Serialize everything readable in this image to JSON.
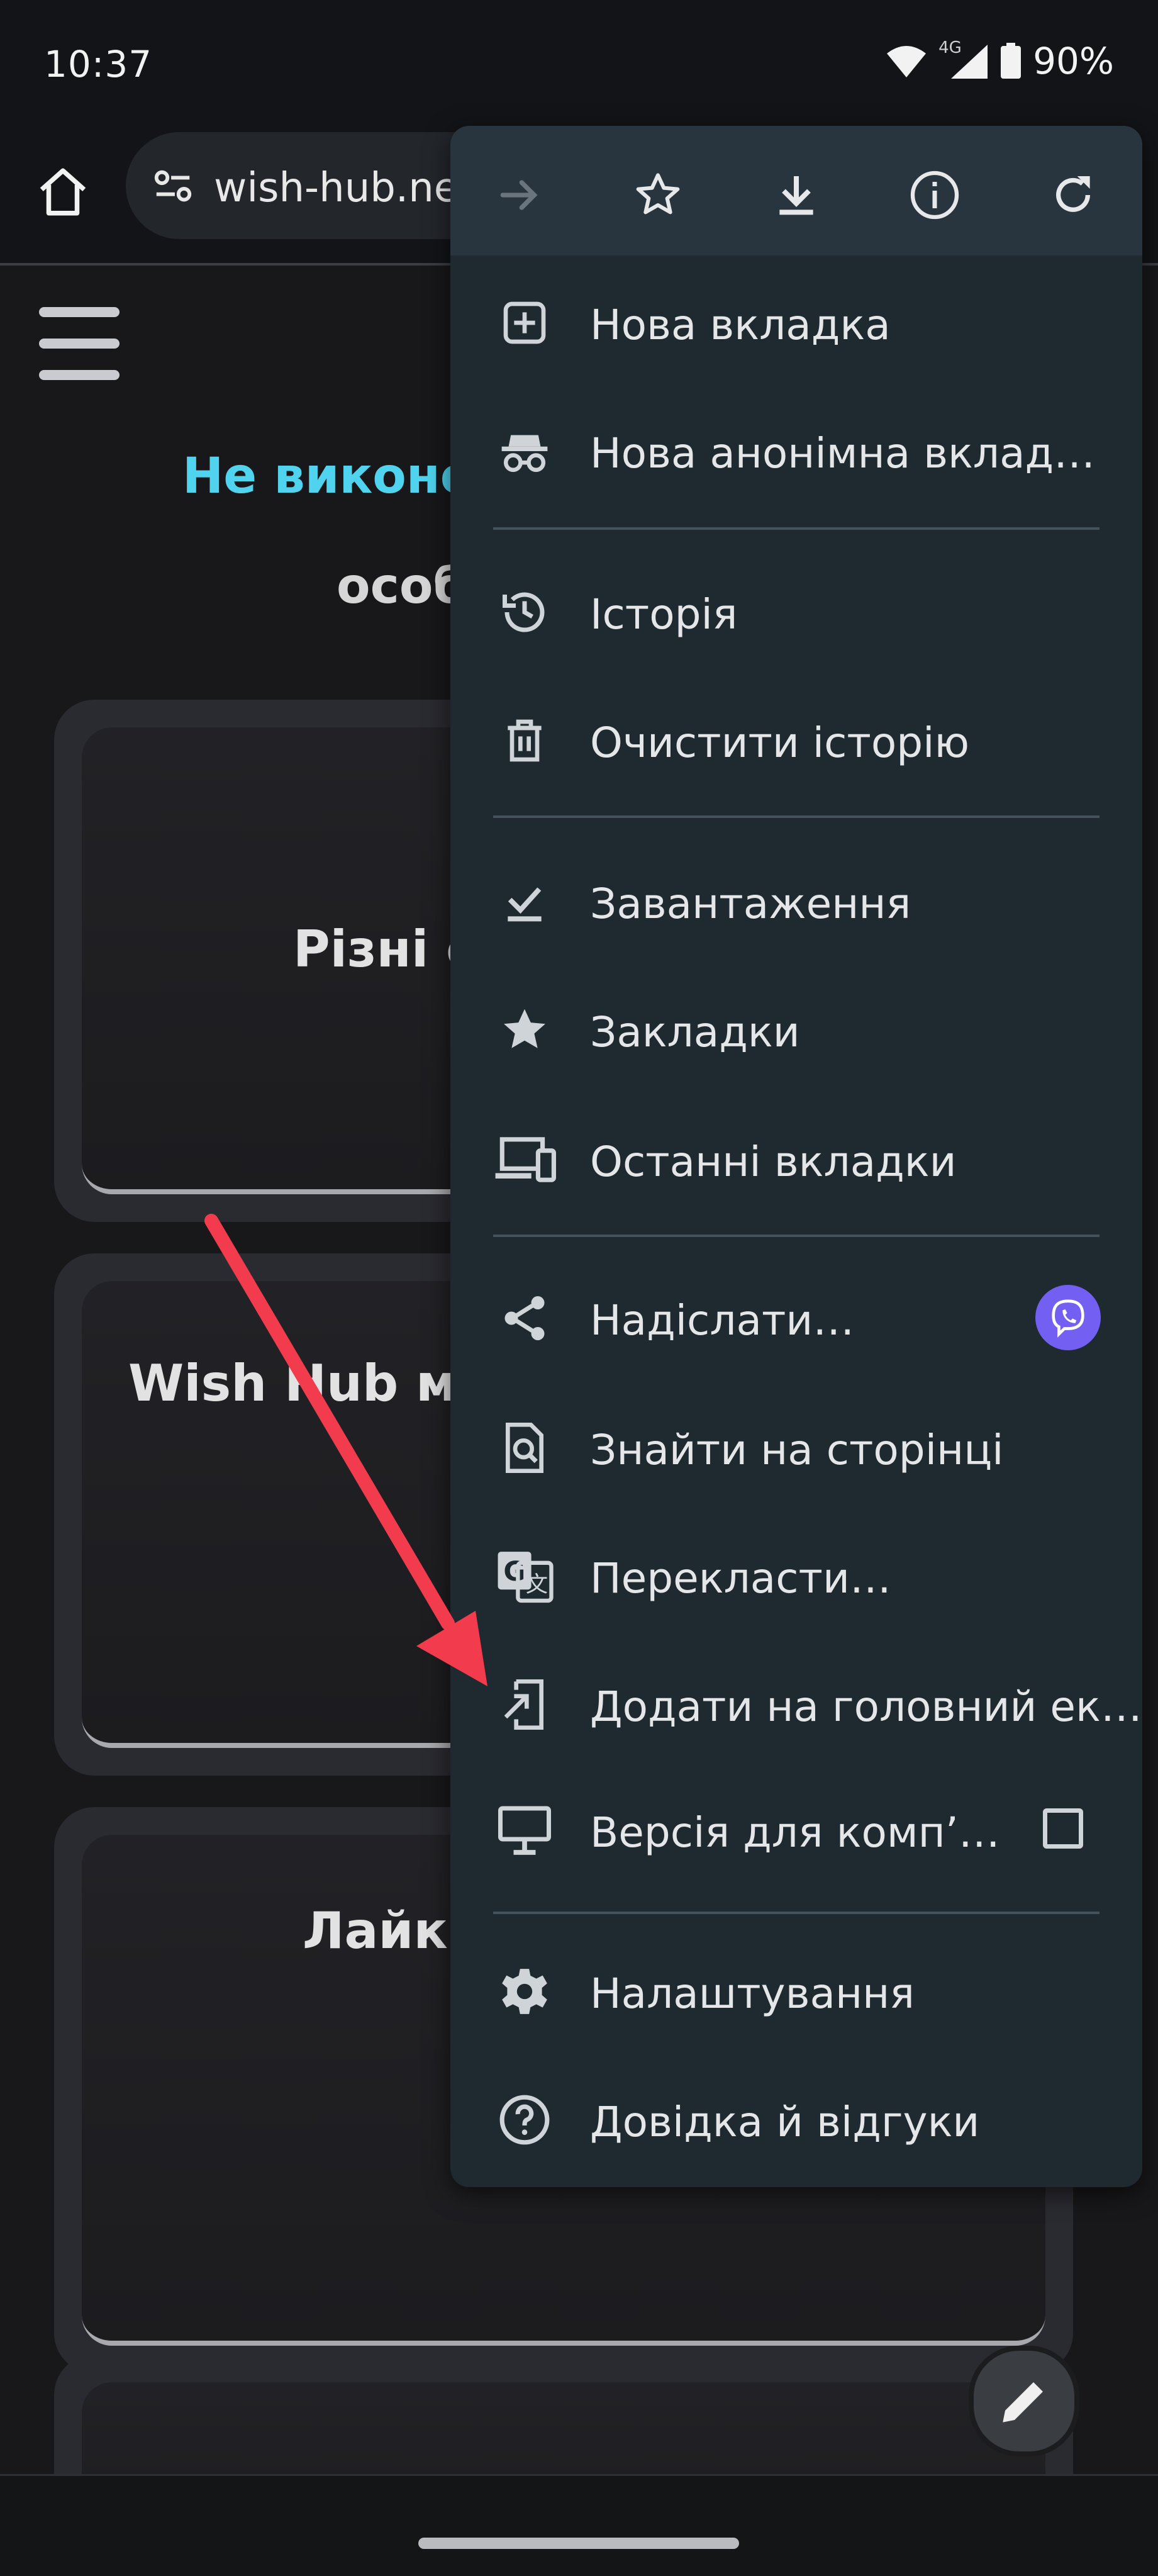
{
  "status_bar": {
    "time": "10:37",
    "network": "4G",
    "battery": "90%"
  },
  "address_bar": {
    "url": "wish-hub.ne"
  },
  "page": {
    "notice_line1": "Не виконо",
    "notice_line2": "особ",
    "cards": [
      {
        "title": "Різні с"
      },
      {
        "title": "Wish Hub мо"
      },
      {
        "title": "Лайки"
      }
    ]
  },
  "menu": {
    "toolbar": [
      "forward-icon",
      "bookmark-star-icon",
      "download-icon",
      "info-icon",
      "refresh-icon"
    ],
    "items": [
      {
        "label": "Нова вкладка",
        "icon": "new-tab-icon"
      },
      {
        "label": "Нова анонімна вклад…",
        "icon": "incognito-icon"
      },
      {
        "label": "Історія",
        "icon": "history-icon"
      },
      {
        "label": "Очистити історію",
        "icon": "trash-icon"
      },
      {
        "label": "Завантаження",
        "icon": "downloads-icon"
      },
      {
        "label": "Закладки",
        "icon": "star-icon"
      },
      {
        "label": "Останні вкладки",
        "icon": "devices-icon"
      },
      {
        "label": "Надіслати…",
        "icon": "share-icon"
      },
      {
        "label": "Знайти на сторінці",
        "icon": "find-icon"
      },
      {
        "label": "Перекласти…",
        "icon": "translate-icon"
      },
      {
        "label": "Додати на головний ек…",
        "icon": "add-to-home-icon"
      },
      {
        "label": "Версія для комп’…",
        "icon": "desktop-icon"
      },
      {
        "label": "Налаштування",
        "icon": "settings-icon"
      },
      {
        "label": "Довідка й відгуки",
        "icon": "help-icon"
      }
    ]
  },
  "colors": {
    "accent_text": "#4fd3ee",
    "menu_bg": "#1f2930",
    "arrow": "#f23b4c",
    "viber": "#7360f2"
  }
}
